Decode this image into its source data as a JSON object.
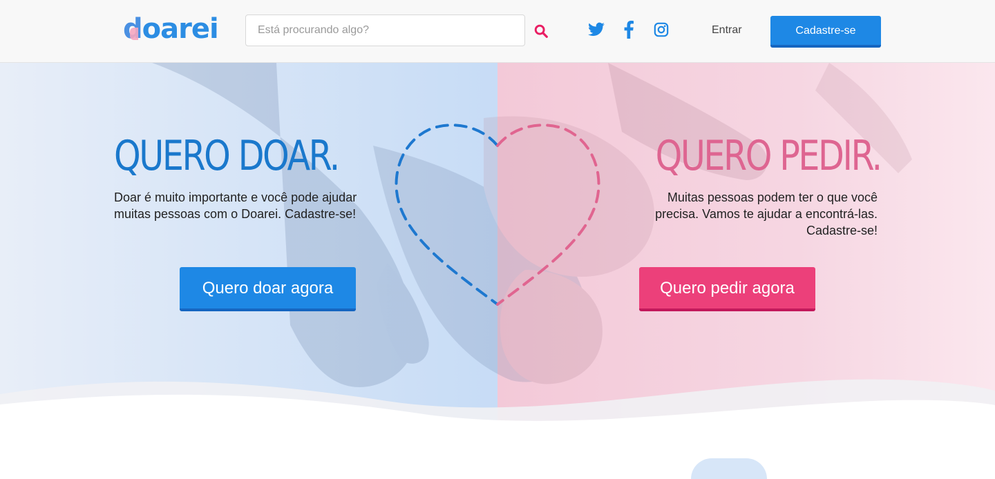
{
  "header": {
    "logo": {
      "first": "d",
      "rest": "oarei"
    },
    "search": {
      "placeholder": "Está procurando algo?",
      "value": ""
    },
    "social_icons": [
      "twitter-icon",
      "facebook-icon",
      "instagram-icon"
    ],
    "login_label": "Entrar",
    "signup_label": "Cadastre-se"
  },
  "hero": {
    "donate": {
      "title": "QUERO DOAR.",
      "text": "Doar é muito importante e você pode ajudar muitas pessoas com o Doarei. Cadastre-se!",
      "button_label": "Quero doar agora"
    },
    "request": {
      "title": "QUERO PEDIR.",
      "text": "Muitas pessoas podem ter o que você precisa. Vamos te ajudar a encontrá-las. Cadastre-se!",
      "button_label": "Quero pedir agora"
    }
  },
  "colors": {
    "primary_blue": "#1e88e5",
    "title_blue": "#1a78cc",
    "primary_pink": "#ec407a",
    "title_pink": "#de6591",
    "search_icon": "#e91e63"
  }
}
